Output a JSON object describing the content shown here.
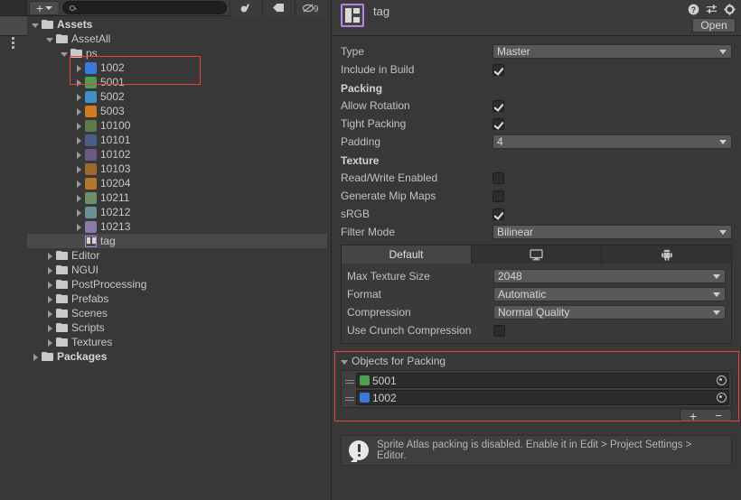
{
  "project_panel": {
    "toolbar": {
      "add_label": "+",
      "add_caret": "chevron-down-icon",
      "search_value": "",
      "search_placeholder": "",
      "icons": [
        "favorite-filter-icon",
        "label-filter-icon",
        "search-filter-icon"
      ]
    },
    "tree": [
      {
        "label": "Assets",
        "depth": 0,
        "expanded": true,
        "icon": "folder",
        "bold": true,
        "selected": false
      },
      {
        "label": "AssetAll",
        "depth": 1,
        "expanded": true,
        "icon": "folder",
        "bold": false,
        "selected": false
      },
      {
        "label": "ps",
        "depth": 2,
        "expanded": true,
        "icon": "folder",
        "bold": false,
        "selected": false
      },
      {
        "label": "1002",
        "depth": 3,
        "expanded": false,
        "icon": "sprite",
        "color": "#3b78d8",
        "selected": false
      },
      {
        "label": "5001",
        "depth": 3,
        "expanded": false,
        "icon": "sprite",
        "color": "#4f9c52",
        "selected": false
      },
      {
        "label": "5002",
        "depth": 3,
        "expanded": false,
        "icon": "sprite",
        "color": "#3f8fc6",
        "selected": false
      },
      {
        "label": "5003",
        "depth": 3,
        "expanded": false,
        "icon": "sprite",
        "color": "#d07a22",
        "selected": false
      },
      {
        "label": "10100",
        "depth": 3,
        "expanded": false,
        "icon": "sprite",
        "color": "#5f7a4a",
        "selected": false
      },
      {
        "label": "10101",
        "depth": 3,
        "expanded": false,
        "icon": "sprite",
        "color": "#4a5e86",
        "selected": false
      },
      {
        "label": "10102",
        "depth": 3,
        "expanded": false,
        "icon": "sprite",
        "color": "#6b5a86",
        "selected": false
      },
      {
        "label": "10103",
        "depth": 3,
        "expanded": false,
        "icon": "sprite",
        "color": "#9a6a2e",
        "selected": false
      },
      {
        "label": "10204",
        "depth": 3,
        "expanded": false,
        "icon": "sprite",
        "color": "#b4782c",
        "selected": false
      },
      {
        "label": "10211",
        "depth": 3,
        "expanded": false,
        "icon": "sprite",
        "color": "#6d8f6a",
        "selected": false
      },
      {
        "label": "10212",
        "depth": 3,
        "expanded": false,
        "icon": "sprite",
        "color": "#6a8f95",
        "selected": false
      },
      {
        "label": "10213",
        "depth": 3,
        "expanded": false,
        "icon": "sprite",
        "color": "#8a7aa8",
        "selected": false
      },
      {
        "label": "tag",
        "depth": 3,
        "expanded": null,
        "icon": "tag",
        "selected": true
      },
      {
        "label": "Editor",
        "depth": 1,
        "expanded": false,
        "icon": "folder",
        "bold": false,
        "selected": false
      },
      {
        "label": "NGUI",
        "depth": 1,
        "expanded": false,
        "icon": "folder",
        "bold": false,
        "selected": false
      },
      {
        "label": "PostProcessing",
        "depth": 1,
        "expanded": false,
        "icon": "folder",
        "bold": false,
        "selected": false
      },
      {
        "label": "Prefabs",
        "depth": 1,
        "expanded": false,
        "icon": "folder",
        "bold": false,
        "selected": false
      },
      {
        "label": "Scenes",
        "depth": 1,
        "expanded": false,
        "icon": "folder",
        "bold": false,
        "selected": false
      },
      {
        "label": "Scripts",
        "depth": 1,
        "expanded": false,
        "icon": "folder",
        "bold": false,
        "selected": false
      },
      {
        "label": "Textures",
        "depth": 1,
        "expanded": false,
        "icon": "folder",
        "bold": false,
        "selected": false
      },
      {
        "label": "Packages",
        "depth": 0,
        "expanded": false,
        "icon": "folder",
        "bold": true,
        "selected": false
      }
    ]
  },
  "inspector": {
    "title": "tag",
    "icon": "sprite-atlas-icon",
    "header_icons": [
      "help-icon",
      "preset-icon",
      "gear-icon"
    ],
    "open_button": "Open",
    "fields": {
      "type_label": "Type",
      "type_value": "Master",
      "include_in_build_label": "Include in Build",
      "include_in_build_checked": true
    },
    "packing": {
      "section": "Packing",
      "allow_rotation_label": "Allow Rotation",
      "allow_rotation_checked": true,
      "tight_packing_label": "Tight Packing",
      "tight_packing_checked": true,
      "padding_label": "Padding",
      "padding_value": "4"
    },
    "texture": {
      "section": "Texture",
      "read_write_label": "Read/Write Enabled",
      "read_write_checked": false,
      "mipmaps_label": "Generate Mip Maps",
      "mipmaps_checked": false,
      "srgb_label": "sRGB",
      "srgb_checked": true,
      "filter_mode_label": "Filter Mode",
      "filter_mode_value": "Bilinear"
    },
    "platform_tabs": [
      {
        "label": "Default",
        "icon": "",
        "active": true
      },
      {
        "label": "",
        "icon": "monitor-icon",
        "active": false
      },
      {
        "label": "",
        "icon": "android-icon",
        "active": false
      }
    ],
    "platform_settings": {
      "max_texture_size_label": "Max Texture Size",
      "max_texture_size_value": "2048",
      "format_label": "Format",
      "format_value": "Automatic",
      "compression_label": "Compression",
      "compression_value": "Normal Quality",
      "crunch_label": "Use Crunch Compression",
      "crunch_checked": false
    },
    "objects_for_packing": {
      "title": "Objects for Packing",
      "expanded": true,
      "rows": [
        {
          "label": "5001",
          "color": "#4f9c52"
        },
        {
          "label": "1002",
          "color": "#3b78d8"
        }
      ],
      "add_label": "+",
      "remove_label": "−"
    },
    "help": {
      "icon": "warning-icon",
      "text": "Sprite Atlas packing is disabled. Enable it in Edit > Project Settings > Editor."
    }
  },
  "annotations": {
    "highlight_color": "#e84040",
    "boxes": [
      "tree-selection-highlight",
      "objects-for-packing-highlight"
    ]
  }
}
